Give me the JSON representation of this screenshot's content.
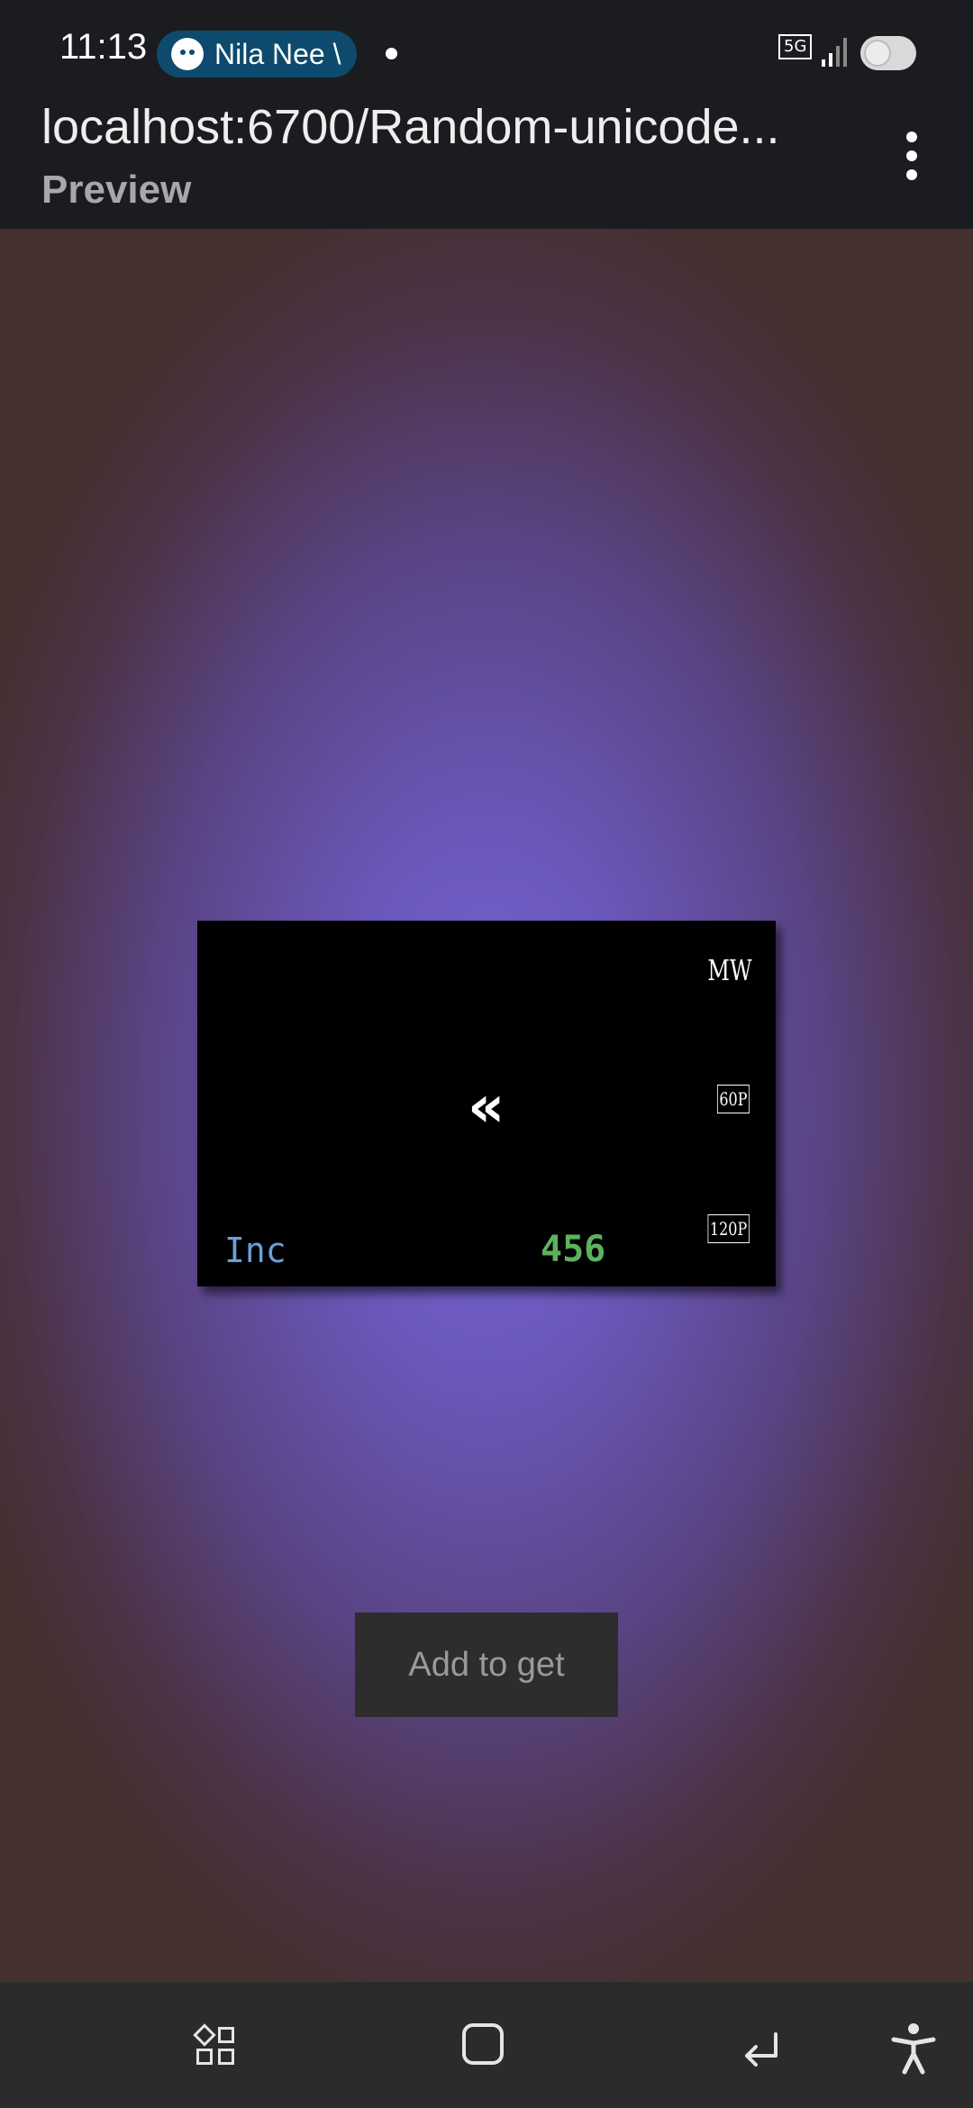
{
  "status_bar": {
    "time": "11:13",
    "pill_text": "Nila Nee \\",
    "network": "5G"
  },
  "app_bar": {
    "url": "localhost:6700/Random-unicode...",
    "subtitle": "Preview",
    "menu_icon": "more-vertical-icon"
  },
  "widget": {
    "top_right": "MW",
    "mid_right": "60P",
    "bottom_right": "120P",
    "center_symbol": "«",
    "label": "Inc",
    "value": "456"
  },
  "add_button": {
    "label": "Add to get"
  },
  "nav_bar": {
    "icons": [
      "recents-icon",
      "home-icon",
      "back-icon",
      "accessibility-icon"
    ]
  },
  "colors": {
    "accent_blue": "#6a9fd8",
    "accent_green": "#5db35d",
    "bg_purple": "#7b68dd"
  }
}
